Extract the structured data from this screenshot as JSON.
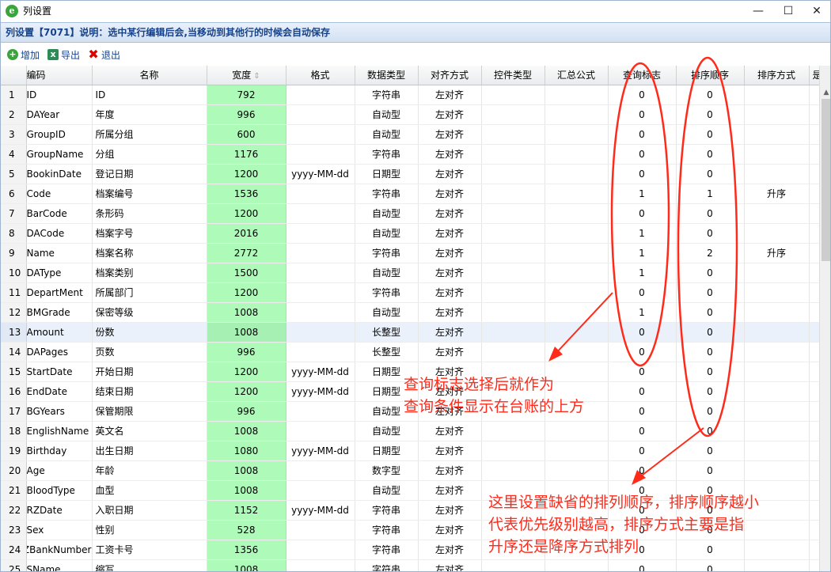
{
  "window": {
    "title": "列设置",
    "minimize_glyph": "—",
    "maximize_glyph": "☐",
    "close_glyph": "✕"
  },
  "subtitle": "列设置【7071】说明：选中某行编辑后会,当移动到其他行的时候会自动保存",
  "toolbar": {
    "add_label": "增加",
    "export_label": "导出",
    "exit_label": "退出"
  },
  "grid": {
    "columns": [
      "编码",
      "名称",
      "宽度",
      "格式",
      "数据类型",
      "对齐方式",
      "控件类型",
      "汇总公式",
      "查询标志",
      "排序顺序",
      "排序方式",
      "是否"
    ],
    "rows": [
      {
        "n": "1",
        "code": "ID",
        "name": "ID",
        "width": "792",
        "format": "",
        "dtype": "字符串",
        "align": "左对齐",
        "ctrl": "",
        "sum": "",
        "query": "0",
        "sort": "0",
        "sortmode": ""
      },
      {
        "n": "2",
        "code": "DAYear",
        "name": "年度",
        "width": "996",
        "format": "",
        "dtype": "自动型",
        "align": "左对齐",
        "ctrl": "",
        "sum": "",
        "query": "0",
        "sort": "0",
        "sortmode": ""
      },
      {
        "n": "3",
        "code": "GroupID",
        "name": "所属分组",
        "width": "600",
        "format": "",
        "dtype": "自动型",
        "align": "左对齐",
        "ctrl": "",
        "sum": "",
        "query": "0",
        "sort": "0",
        "sortmode": ""
      },
      {
        "n": "4",
        "code": "GroupName",
        "name": "分组",
        "width": "1176",
        "format": "",
        "dtype": "字符串",
        "align": "左对齐",
        "ctrl": "",
        "sum": "",
        "query": "0",
        "sort": "0",
        "sortmode": ""
      },
      {
        "n": "5",
        "code": "BookinDate",
        "name": "登记日期",
        "width": "1200",
        "format": "yyyy-MM-dd",
        "dtype": "日期型",
        "align": "左对齐",
        "ctrl": "",
        "sum": "",
        "query": "0",
        "sort": "0",
        "sortmode": ""
      },
      {
        "n": "6",
        "code": "Code",
        "name": "档案编号",
        "width": "1536",
        "format": "",
        "dtype": "字符串",
        "align": "左对齐",
        "ctrl": "",
        "sum": "",
        "query": "1",
        "sort": "1",
        "sortmode": "升序"
      },
      {
        "n": "7",
        "code": "BarCode",
        "name": "条形码",
        "width": "1200",
        "format": "",
        "dtype": "自动型",
        "align": "左对齐",
        "ctrl": "",
        "sum": "",
        "query": "0",
        "sort": "0",
        "sortmode": ""
      },
      {
        "n": "8",
        "code": "DACode",
        "name": "档案字号",
        "width": "2016",
        "format": "",
        "dtype": "自动型",
        "align": "左对齐",
        "ctrl": "",
        "sum": "",
        "query": "1",
        "sort": "0",
        "sortmode": ""
      },
      {
        "n": "9",
        "code": "Name",
        "name": "档案名称",
        "width": "2772",
        "format": "",
        "dtype": "字符串",
        "align": "左对齐",
        "ctrl": "",
        "sum": "",
        "query": "1",
        "sort": "2",
        "sortmode": "升序"
      },
      {
        "n": "10",
        "code": "DAType",
        "name": "档案类别",
        "width": "1500",
        "format": "",
        "dtype": "自动型",
        "align": "左对齐",
        "ctrl": "",
        "sum": "",
        "query": "1",
        "sort": "0",
        "sortmode": ""
      },
      {
        "n": "11",
        "code": "DepartMent",
        "name": "所属部门",
        "width": "1200",
        "format": "",
        "dtype": "字符串",
        "align": "左对齐",
        "ctrl": "",
        "sum": "",
        "query": "0",
        "sort": "0",
        "sortmode": ""
      },
      {
        "n": "12",
        "code": "BMGrade",
        "name": "保密等级",
        "width": "1008",
        "format": "",
        "dtype": "自动型",
        "align": "左对齐",
        "ctrl": "",
        "sum": "",
        "query": "1",
        "sort": "0",
        "sortmode": ""
      },
      {
        "n": "13",
        "code": "Amount",
        "name": "份数",
        "width": "1008",
        "format": "",
        "dtype": "长整型",
        "align": "左对齐",
        "ctrl": "",
        "sum": "",
        "query": "0",
        "sort": "0",
        "sortmode": ""
      },
      {
        "n": "14",
        "code": "DAPages",
        "name": "页数",
        "width": "996",
        "format": "",
        "dtype": "长整型",
        "align": "左对齐",
        "ctrl": "",
        "sum": "",
        "query": "0",
        "sort": "0",
        "sortmode": ""
      },
      {
        "n": "15",
        "code": "StartDate",
        "name": "开始日期",
        "width": "1200",
        "format": "yyyy-MM-dd",
        "dtype": "日期型",
        "align": "左对齐",
        "ctrl": "",
        "sum": "",
        "query": "0",
        "sort": "0",
        "sortmode": ""
      },
      {
        "n": "16",
        "code": "EndDate",
        "name": "结束日期",
        "width": "1200",
        "format": "yyyy-MM-dd",
        "dtype": "日期型",
        "align": "左对齐",
        "ctrl": "",
        "sum": "",
        "query": "0",
        "sort": "0",
        "sortmode": ""
      },
      {
        "n": "17",
        "code": "BGYears",
        "name": "保管期限",
        "width": "996",
        "format": "",
        "dtype": "自动型",
        "align": "左对齐",
        "ctrl": "",
        "sum": "",
        "query": "0",
        "sort": "0",
        "sortmode": ""
      },
      {
        "n": "18",
        "code": "EnglishName",
        "name": "英文名",
        "width": "1008",
        "format": "",
        "dtype": "自动型",
        "align": "左对齐",
        "ctrl": "",
        "sum": "",
        "query": "0",
        "sort": "0",
        "sortmode": ""
      },
      {
        "n": "19",
        "code": "Birthday",
        "name": "出生日期",
        "width": "1080",
        "format": "yyyy-MM-dd",
        "dtype": "日期型",
        "align": "左对齐",
        "ctrl": "",
        "sum": "",
        "query": "0",
        "sort": "0",
        "sortmode": ""
      },
      {
        "n": "20",
        "code": "Age",
        "name": "年龄",
        "width": "1008",
        "format": "",
        "dtype": "数字型",
        "align": "左对齐",
        "ctrl": "",
        "sum": "",
        "query": "0",
        "sort": "0",
        "sortmode": ""
      },
      {
        "n": "21",
        "code": "BloodType",
        "name": "血型",
        "width": "1008",
        "format": "",
        "dtype": "自动型",
        "align": "左对齐",
        "ctrl": "",
        "sum": "",
        "query": "0",
        "sort": "0",
        "sortmode": ""
      },
      {
        "n": "22",
        "code": "RZDate",
        "name": "入职日期",
        "width": "1152",
        "format": "yyyy-MM-dd",
        "dtype": "字符串",
        "align": "左对齐",
        "ctrl": "",
        "sum": "",
        "query": "0",
        "sort": "0",
        "sortmode": ""
      },
      {
        "n": "23",
        "code": "Sex",
        "name": "性别",
        "width": "528",
        "format": "",
        "dtype": "字符串",
        "align": "左对齐",
        "ctrl": "",
        "sum": "",
        "query": "0",
        "sort": "0",
        "sortmode": ""
      },
      {
        "n": "24",
        "code": "GZBankNumber",
        "name": "工资卡号",
        "width": "1356",
        "format": "",
        "dtype": "字符串",
        "align": "左对齐",
        "ctrl": "",
        "sum": "",
        "query": "0",
        "sort": "0",
        "sortmode": ""
      },
      {
        "n": "25",
        "code": "SName",
        "name": "缩写",
        "width": "1008",
        "format": "",
        "dtype": "字符串",
        "align": "左对齐",
        "ctrl": "",
        "sum": "",
        "query": "0",
        "sort": "0",
        "sortmode": ""
      }
    ]
  },
  "annotations": {
    "note1_line1": "查询标志选择后就作为",
    "note1_line2": "查询条件显示在台账的上方",
    "note2_line1": "这里设置缺省的排列顺序，排序顺序越小",
    "note2_line2": "代表优先级别越高，排序方式主要是指",
    "note2_line3": "升序还是降序方式排列",
    "color": "#ff2a1a"
  }
}
